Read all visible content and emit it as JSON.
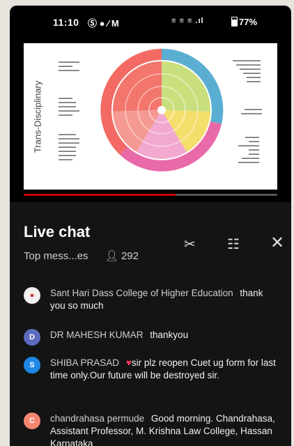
{
  "status_bar": {
    "time": "11:10",
    "icons_left": "Ⓢ ● ∕ M",
    "icons_right": "≡ ≡ ≡ .ıl",
    "battery": "77%"
  },
  "slide": {
    "vertical_title": "Trans-Disciplinary"
  },
  "chat": {
    "title": "Live chat",
    "filter_label": "Top mess...es",
    "viewer_count": "292",
    "icons": [
      "scissors-icon",
      "sliders-icon",
      "close-icon"
    ],
    "colors": {
      "background": "#141414",
      "heart": "#ff3b5c"
    },
    "messages": [
      {
        "author": "Sant Hari Dass College of Higher Education",
        "text": "thank you so much",
        "avatar_letter": "",
        "avatar_color": "#f0f0f0"
      },
      {
        "author": "DR MAHESH KUMAR",
        "text": "thankyou",
        "avatar_letter": "D",
        "avatar_color": "#5c6bc0"
      },
      {
        "author": "SHIBA PRASAD",
        "text": "sir plz reopen Cuet ug form for last time only.Our future will be destroyed sir.",
        "avatar_letter": "S",
        "avatar_color": "#1e88e5"
      },
      {
        "author": "chandrahasa permude",
        "text": "Good morning. Chandrahasa, Assistant Professor, M. Krishna Law College, Hassan Karnataka",
        "avatar_letter": "C",
        "avatar_color": "#f4866f"
      }
    ]
  }
}
